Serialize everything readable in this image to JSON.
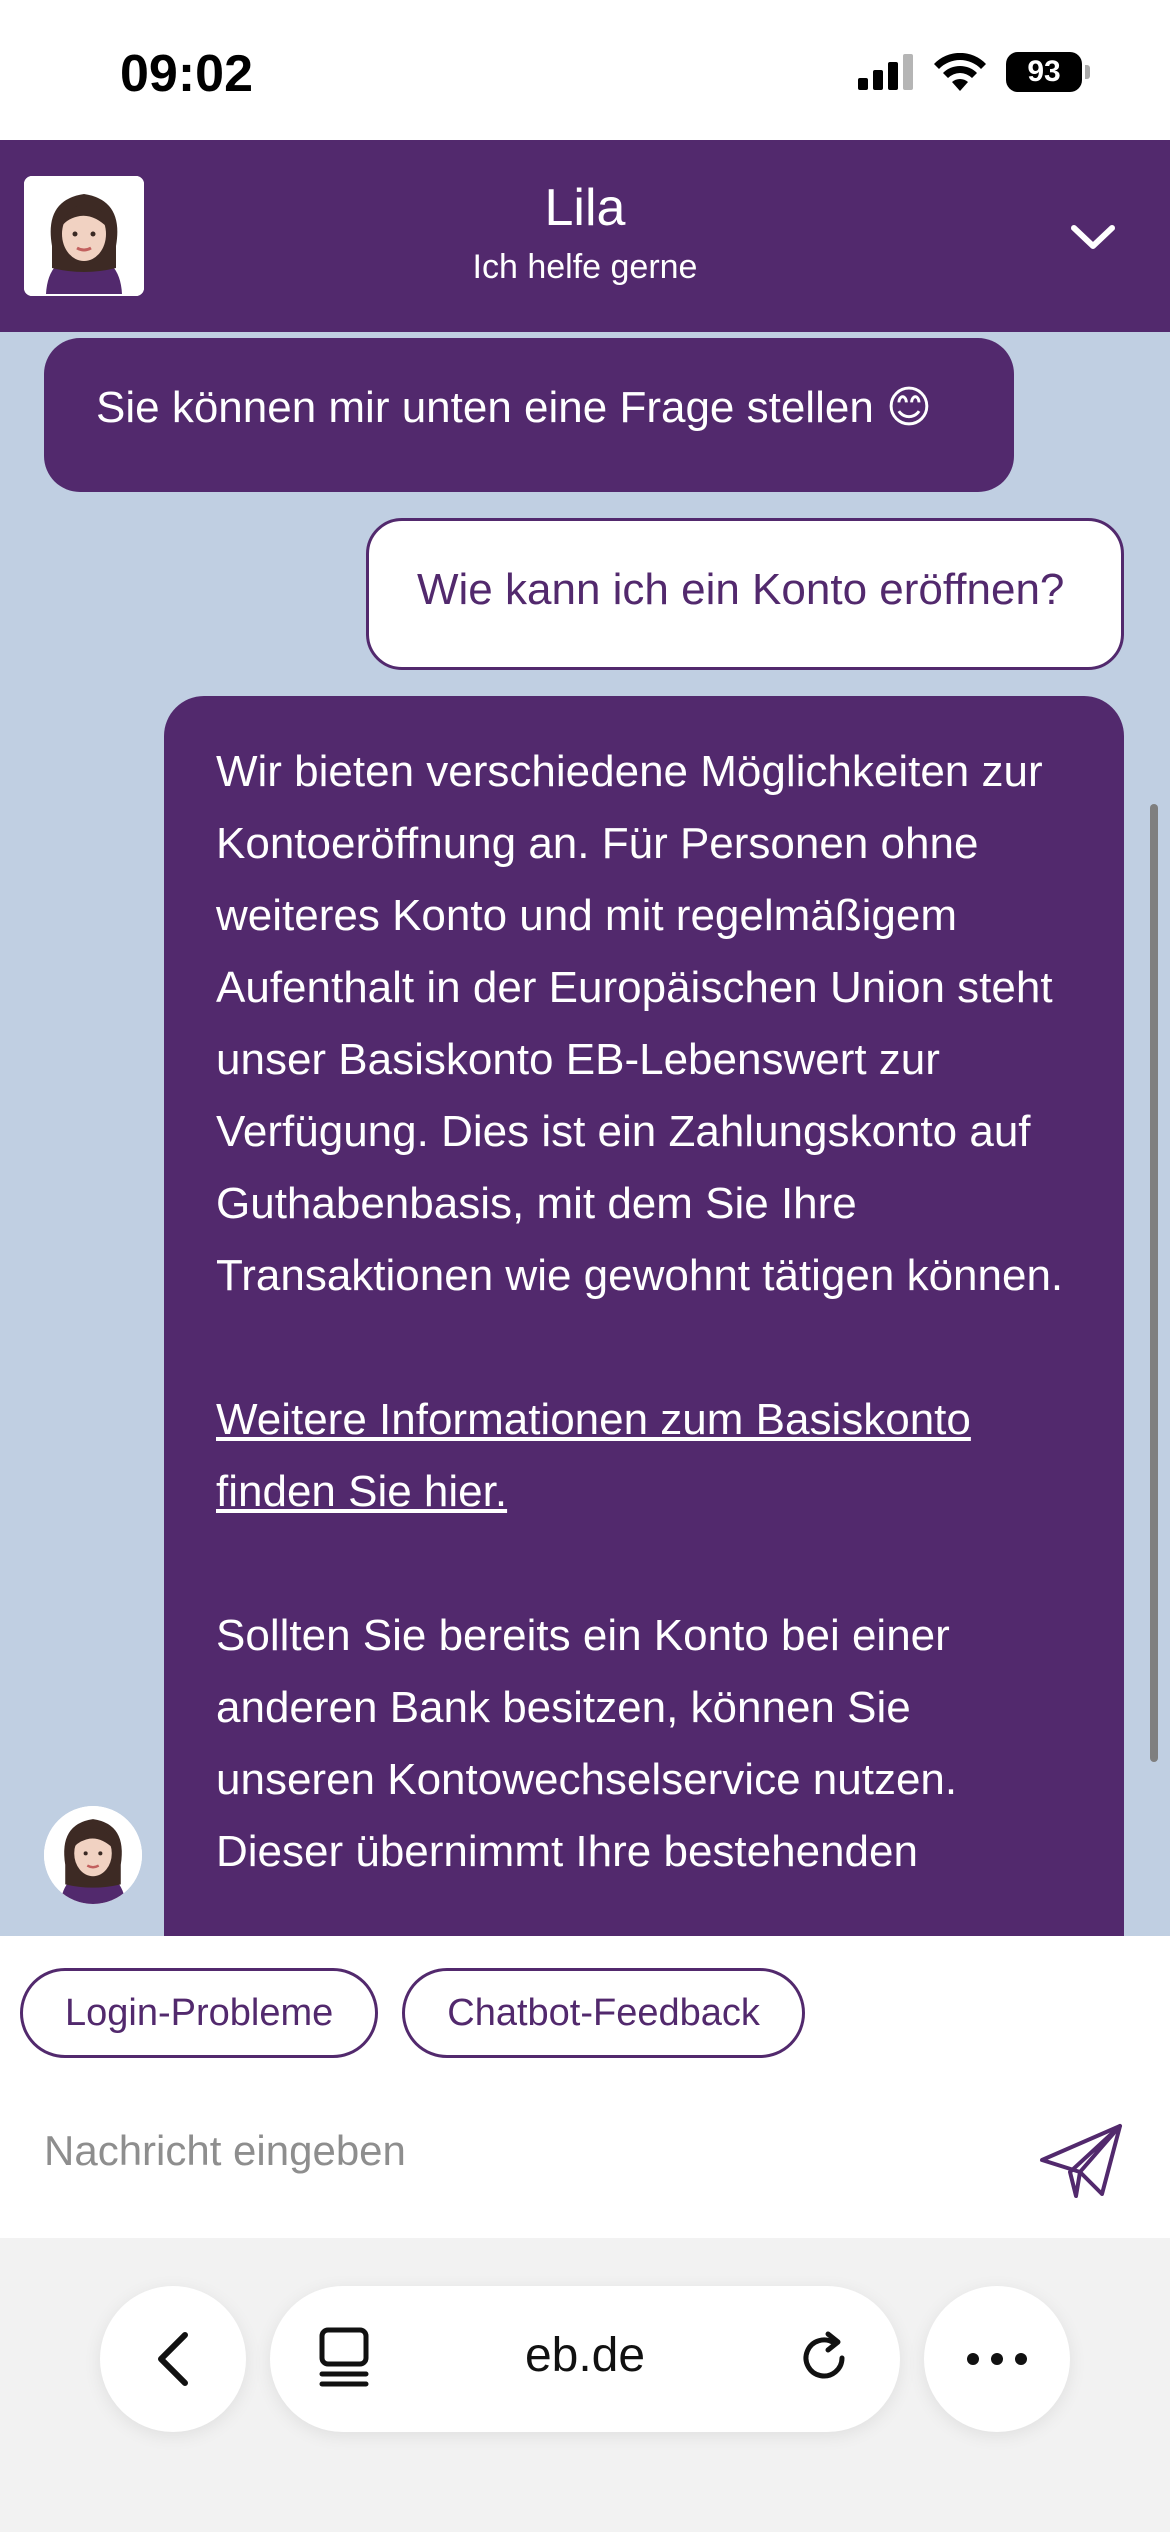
{
  "status_bar": {
    "time": "09:02",
    "battery": "93",
    "icons": [
      "signal-icon",
      "wifi-icon",
      "battery-icon"
    ]
  },
  "header": {
    "title": "Lila",
    "subtitle": "Ich helfe gerne",
    "collapse_icon": "chevron-down-icon"
  },
  "messages": {
    "bot_1": "Sie können mir unten eine Frage stellen 😊",
    "user_1": "Wie kann ich ein Konto eröffnen?",
    "bot_2": {
      "paragraph_1": "Wir bieten verschiedene Möglichkeiten zur Kontoeröffnung an. Für Personen ohne weiteres Konto und mit regelmäßigem Aufenthalt in der Europäischen Union steht unser Basiskonto EB-Lebenswert zur Verfügung. Dies ist ein Zahlungskonto auf Guthabenbasis, mit dem Sie Ihre Transaktionen wie gewohnt tätigen können.",
      "link": "Weitere Informationen zum Basiskonto finden Sie hier.",
      "paragraph_2": "Sollten Sie bereits ein Konto bei einer anderen Bank besitzen, können Sie unseren Kontowechselservice nutzen. Dieser übernimmt Ihre bestehenden"
    }
  },
  "quick_replies": [
    "Login-Probleme",
    "Chatbot-Feedback"
  ],
  "input": {
    "placeholder": "Nachricht eingeben",
    "value": ""
  },
  "browser": {
    "url": "eb.de",
    "icons": [
      "back-icon",
      "tabs-icon",
      "reload-icon",
      "more-icon"
    ]
  },
  "colors": {
    "brand": "#52296d",
    "chat_background": "#c0cfe2",
    "white": "#ffffff"
  }
}
